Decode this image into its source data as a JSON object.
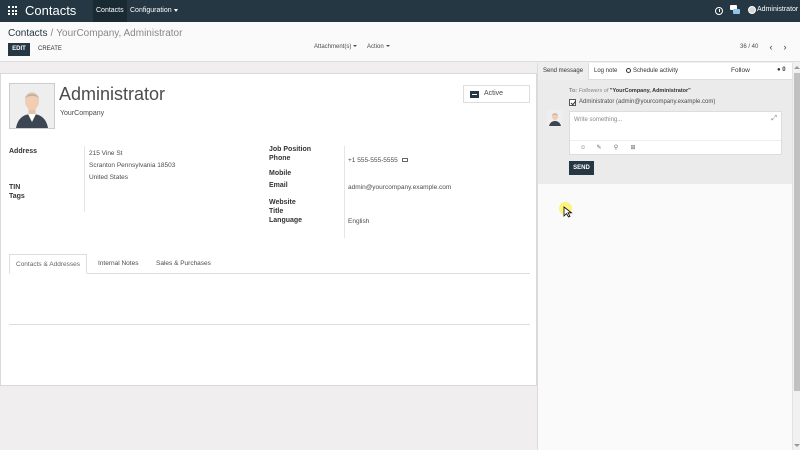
{
  "navbar": {
    "brand": "Contacts",
    "menus": [
      "Contacts",
      "Configuration"
    ],
    "user": "Administrator"
  },
  "control_panel": {
    "breadcrumb": [
      "Contacts",
      "YourCompany, Administrator"
    ],
    "breadcrumb_sep": "/",
    "edit_label": "EDIT",
    "create_label": "CREATE",
    "attachments_label": "Attachment(s)",
    "action_label": "Action",
    "pager": "36 / 40"
  },
  "form": {
    "name": "Administrator",
    "company": "YourCompany",
    "active_label": "Active",
    "address_label": "Address",
    "address_lines": [
      "215 Vine St",
      "Scranton  Pennsylvania  18503",
      "United States"
    ],
    "tin_label": "TIN",
    "tags_label": "Tags",
    "job_position_label": "Job Position",
    "phone_label": "Phone",
    "phone_value": "+1 555-555-5555",
    "mobile_label": "Mobile",
    "email_label": "Email",
    "email_value": "admin@yourcompany.example.com",
    "website_label": "Website",
    "title_label": "Title",
    "language_label": "Language",
    "language_value": "English",
    "tabs": [
      "Contacts & Addresses",
      "Internal Notes",
      "Sales & Purchases"
    ]
  },
  "chatter": {
    "send_message": "Send message",
    "log_note": "Log note",
    "schedule_activity": "Schedule activity",
    "follow": "Follow",
    "followers_count": "0",
    "to_prefix": "To:",
    "to_followers": "Followers of",
    "to_record": "\"YourCompany, Administrator\"",
    "recipient": "Administrator (admin@yourcompany.example.com)",
    "placeholder": "Write something...",
    "send_label": "SEND"
  },
  "colors": {
    "navbar": "#243742",
    "primary": "#243742",
    "background": "#f0eeee"
  }
}
